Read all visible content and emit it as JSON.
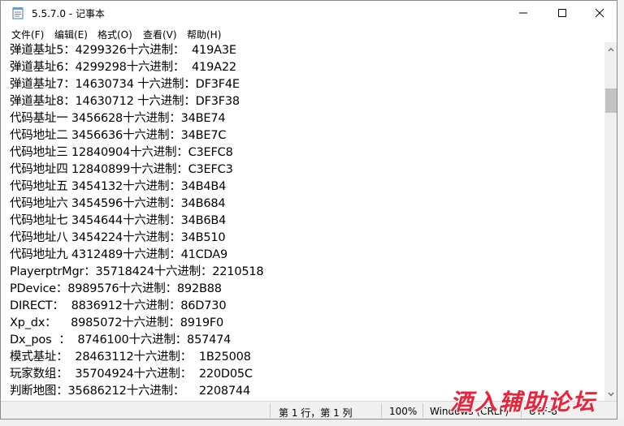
{
  "window": {
    "title": "5.5.7.0 - 记事本"
  },
  "menu": [
    {
      "label": "文件(F)"
    },
    {
      "label": "编辑(E)"
    },
    {
      "label": "格式(O)"
    },
    {
      "label": "查看(V)"
    },
    {
      "label": "帮助(H)"
    }
  ],
  "lines": [
    "弹道基址5：4299326十六进制：  419A3E",
    "弹道基址6：4299298十六进制：  419A22",
    "弹道基址7：14630734 十六进制：DF3F4E",
    "弹道基址8：14630712 十六进制：DF3F38",
    "代码基址一 3456628十六进制：34BE74",
    "代码地址二 3456636十六进制：34BE7C",
    "代码地址三 12840904十六进制：C3EFC8",
    "代码地址四 12840899十六进制：C3EFC3",
    "代码地址五 3454132十六进制：34B4B4",
    "代码地址六 3454596十六进制：34B684",
    "代码地址七 3454644十六进制：34B6B4",
    "代码地址八 3454224十六进制：34B510",
    "代码地址九 4312489十六进制：41CDA9",
    "PlayerptrMgr：35718424十六进制：2210518",
    "PDevice：8989576十六进制：892B88",
    "DIRECT：  8836912十六进制：86D730",
    "Xp_dx：    8985072十六进制：8919F0",
    "Dx_pos  ：  8746100十六进制：857474",
    "模式基址：  28463112十六进制：  1B25008",
    "玩家数组：  35704924十六进制：  220D05C",
    "判断地图：35686212十六进制：    2208744"
  ],
  "status": {
    "position": "第 1 行，第 1 列",
    "zoom": "100%",
    "line_ending": "Windows (CRLF)",
    "encoding": "UTF-8"
  },
  "watermark": "酒入辅助论坛",
  "icons": {
    "app": "notepad-icon",
    "minimize": "minimize-icon",
    "maximize": "maximize-icon",
    "close": "close-icon"
  }
}
